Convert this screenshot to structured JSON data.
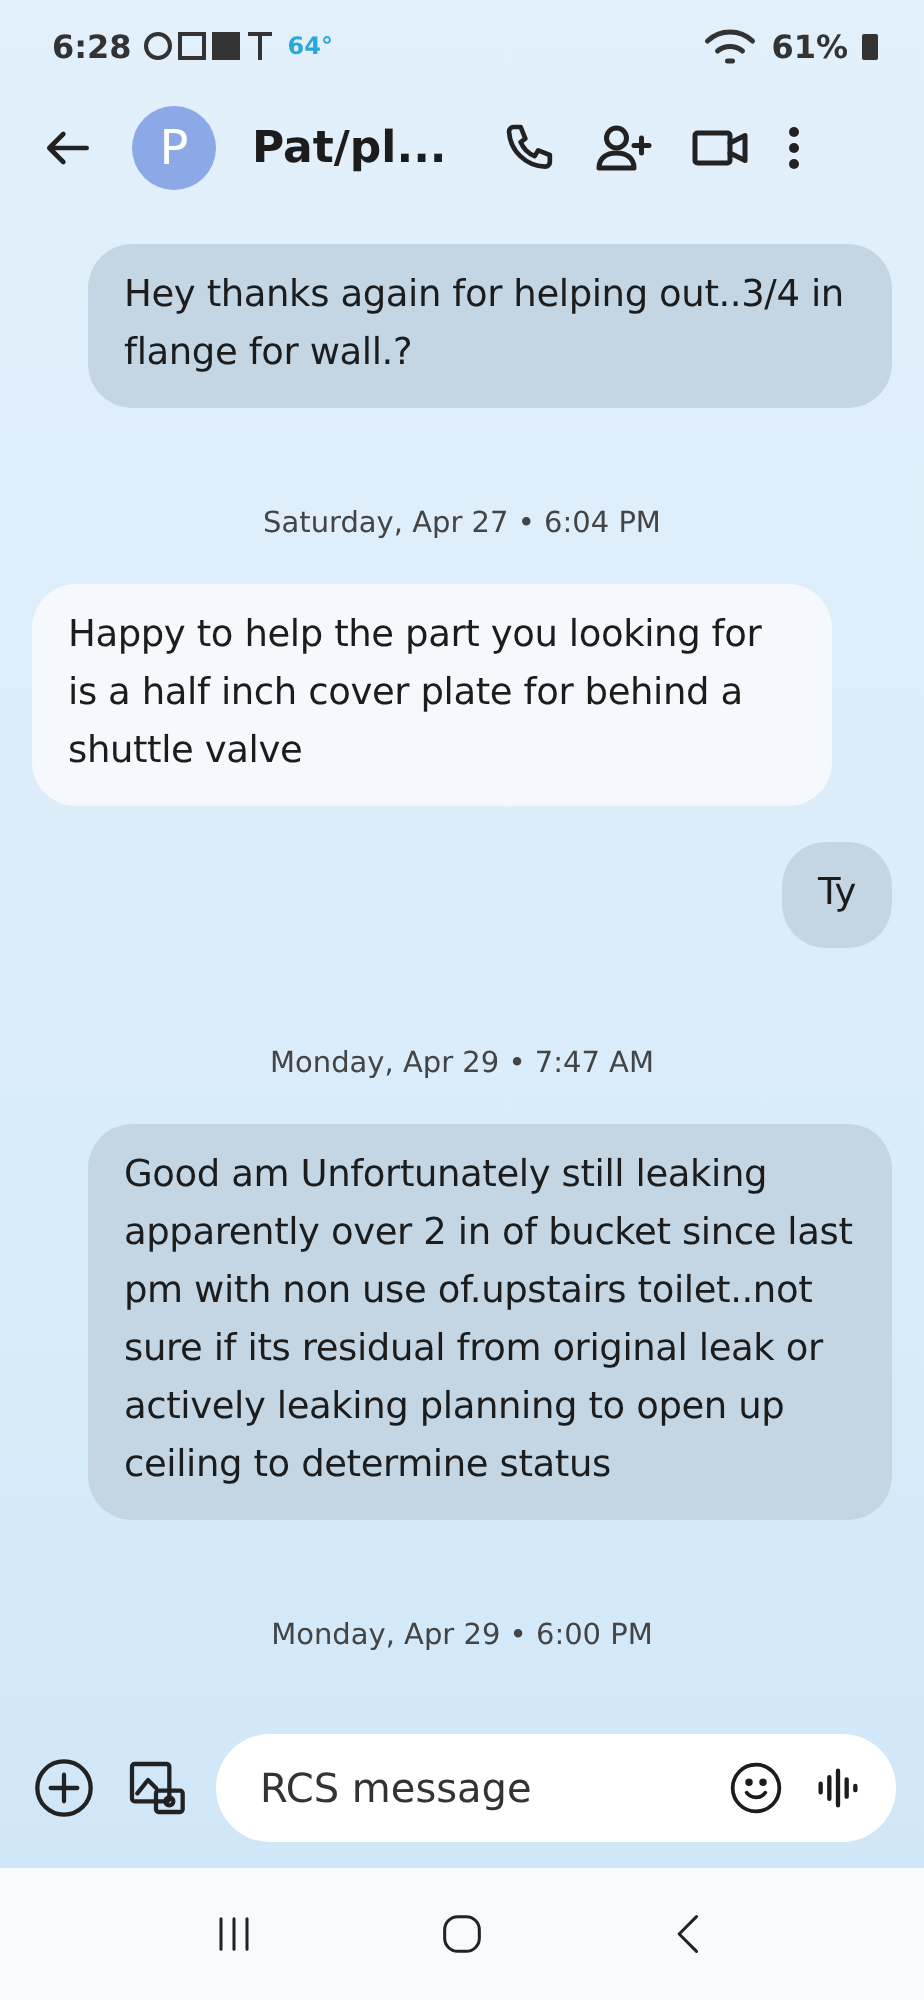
{
  "status_bar": {
    "time": "6:28",
    "temperature": "64°",
    "battery": "61%"
  },
  "header": {
    "avatar_letter": "P",
    "contact": "Pat/pl..."
  },
  "messages": [
    {
      "kind": "outgoing",
      "text": "Hey thanks again for helping out..3/4 in flange for wall.?"
    },
    {
      "kind": "timestamp",
      "text": "Saturday, Apr 27 • 6:04 PM"
    },
    {
      "kind": "incoming",
      "text": "Happy to help the part you looking for is a half inch cover plate for behind a shuttle valve"
    },
    {
      "kind": "outgoing",
      "text": "Ty"
    },
    {
      "kind": "timestamp",
      "text": "Monday, Apr 29 • 7:47 AM"
    },
    {
      "kind": "outgoing",
      "text": "Good am Unfortunately still leaking apparently over 2 in of bucket since last pm with non use of.upstairs toilet..not sure if its residual from original leak or actively leaking planning to open up ceiling to determine status"
    },
    {
      "kind": "timestamp",
      "text": "Monday, Apr 29 • 6:00 PM"
    }
  ],
  "composer": {
    "placeholder": "RCS message"
  }
}
